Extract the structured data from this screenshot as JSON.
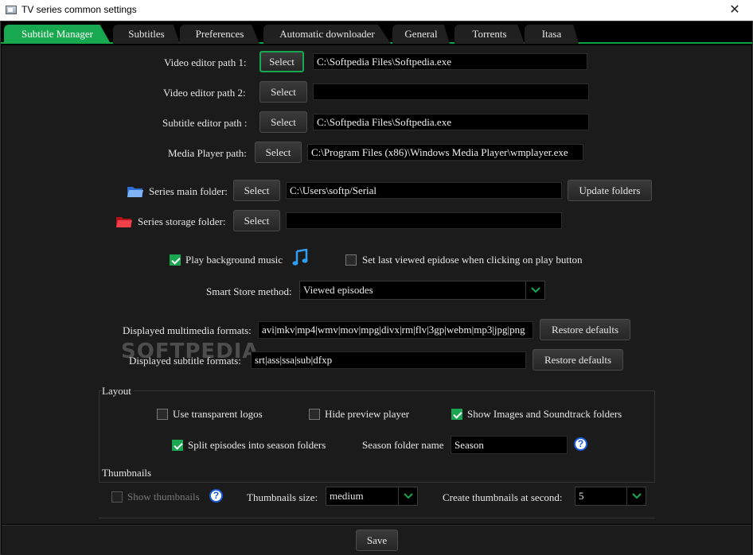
{
  "window": {
    "title": "TV series common settings",
    "close_glyph": "✕"
  },
  "tabs": [
    {
      "label": "Subtitle Manager",
      "active": true
    },
    {
      "label": "Subtitles"
    },
    {
      "label": "Preferences"
    },
    {
      "label": "Automatic downloader"
    },
    {
      "label": "General"
    },
    {
      "label": "Torrents"
    },
    {
      "label": "Itasa"
    }
  ],
  "paths": {
    "video_editor_1": {
      "label": "Video editor path 1:",
      "button": "Select",
      "value": "C:\\Softpedia Files\\Softpedia.exe"
    },
    "video_editor_2": {
      "label": "Video editor path 2:",
      "button": "Select",
      "value": ""
    },
    "subtitle_editor": {
      "label": "Subtitle editor path :",
      "button": "Select",
      "value": "C:\\Softpedia Files\\Softpedia.exe"
    },
    "media_player": {
      "label": "Media Player path:",
      "button": "Select",
      "value": "C:\\Program Files (x86)\\Windows Media Player\\wmplayer.exe"
    }
  },
  "folders": {
    "main": {
      "label": "Series main folder:",
      "button": "Select",
      "value": "C:\\Users\\softp/Serial",
      "icon": "folder-blue-icon",
      "update_button": "Update folders"
    },
    "storage": {
      "label": "Series storage folder:",
      "button": "Select",
      "value": "",
      "icon": "folder-red-icon"
    }
  },
  "playback": {
    "bg_music": {
      "label": "Play background music",
      "checked": true
    },
    "last_viewed": {
      "label": "Set last viewed epidose when clicking on play button",
      "checked": false
    }
  },
  "smart_store": {
    "label": "Smart Store method:",
    "value": "Viewed episodes"
  },
  "formats": {
    "multimedia": {
      "label": "Displayed multimedia formats:",
      "value": "avi|mkv|mp4|wmv|mov|mpg|divx|rm|flv|3gp|webm|mp3|jpg|png",
      "button": "Restore defaults"
    },
    "subtitle": {
      "label": "Displayed subtitle formats:",
      "value": "srt|ass|ssa|sub|dfxp",
      "button": "Restore defaults"
    }
  },
  "layout": {
    "title": "Layout",
    "transparent_logos": {
      "label": "Use transparent logos",
      "checked": false
    },
    "hide_preview": {
      "label": "Hide preview player",
      "checked": false
    },
    "show_images": {
      "label": "Show Images and Soundtrack folders",
      "checked": true
    },
    "split_episodes": {
      "label": "Split episodes into season folders",
      "checked": true
    },
    "season_folder": {
      "label": "Season folder name",
      "value": "Season"
    }
  },
  "thumbnails": {
    "title": "Thumbnails",
    "show": {
      "label": "Show thumbnails",
      "checked": false,
      "disabled": true
    },
    "size": {
      "label": "Thumbnails size:",
      "value": "medium"
    },
    "second": {
      "label": "Create thumbnails at second:",
      "value": "5"
    }
  },
  "footer": {
    "save": "Save"
  },
  "watermark": "SOFTPEDIA",
  "colors": {
    "accent": "#18a84f",
    "panel": "#1b1b1b",
    "help": "#1a5bd8"
  }
}
